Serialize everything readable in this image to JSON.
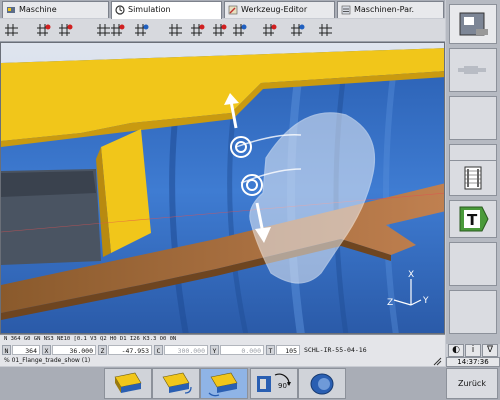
{
  "tabs": [
    {
      "label": "Maschine",
      "icon": "machine-icon",
      "active": false
    },
    {
      "label": "Simulation",
      "icon": "simulation-icon",
      "active": true
    },
    {
      "label": "Werkzeug-Editor",
      "icon": "tool-editor-icon",
      "active": false
    },
    {
      "label": "Maschinen-Par.",
      "icon": "machine-params-icon",
      "active": false
    }
  ],
  "status": {
    "nc_line": "N 364  G0 GN NS3 NE10 [0.1 V3 Q2 H0 D1 I26 K3.3 O0 0N",
    "coords": [
      {
        "label": "N",
        "value": "364",
        "dim": false
      },
      {
        "label": "X",
        "value": "36.000",
        "dim": false
      },
      {
        "label": "Z",
        "value": "-47.953",
        "dim": false
      },
      {
        "label": "C",
        "value": "300.000",
        "dim": true
      },
      {
        "label": "Y",
        "value": "0.000",
        "dim": true
      },
      {
        "label": "T",
        "value": "105",
        "dim": false
      }
    ],
    "tool_name": "SCHL-IR-55-04-16",
    "program": "% 01_Flange_trade_show (1)"
  },
  "viewport": {
    "axes": {
      "x": "X",
      "z": "Z",
      "y": "Y"
    },
    "colors": {
      "background": "#2f67b8",
      "yellow": "#f1c61a",
      "brown": "#b4703c",
      "bg_light": "#cfd8e6"
    }
  },
  "side": {
    "mode_buttons": [
      "◐",
      "i",
      "∇"
    ],
    "clock": "14:37:36"
  },
  "bottom": {
    "back_label": "Zurück",
    "rotate_label": "90°"
  }
}
